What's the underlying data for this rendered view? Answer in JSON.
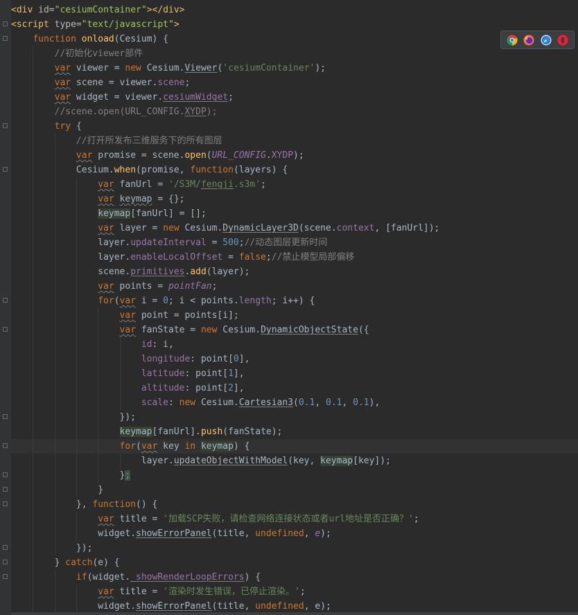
{
  "editor": {
    "lines": [
      {
        "indent": 0,
        "fold": false,
        "tokens": [
          [
            "tag",
            "<div "
          ],
          [
            "attr",
            "id="
          ],
          [
            "val",
            "\"cesiumContainer\""
          ],
          [
            "tag",
            "></div>"
          ]
        ]
      },
      {
        "indent": 0,
        "fold": true,
        "tokens": [
          [
            "tag",
            "<script "
          ],
          [
            "attr",
            "type="
          ],
          [
            "val",
            "\"text/javascript\""
          ],
          [
            "tag",
            ">"
          ]
        ]
      },
      {
        "indent": 1,
        "fold": true,
        "tokens": [
          [
            "kw",
            "function "
          ],
          [
            "fn",
            "onload"
          ],
          [
            "p",
            "(Cesium) {"
          ]
        ]
      },
      {
        "indent": 2,
        "fold": false,
        "tokens": [
          [
            "cmt",
            "//初始化viewer部件"
          ]
        ]
      },
      {
        "indent": 2,
        "fold": false,
        "tokens": [
          [
            "kw w",
            "var"
          ],
          [
            "p",
            " viewer = "
          ],
          [
            "kw",
            "new "
          ],
          [
            "p",
            "Cesium."
          ],
          [
            "p u",
            "Viewer"
          ],
          [
            "p",
            "("
          ],
          [
            "str",
            "'cesiumContainer'"
          ],
          [
            "p",
            ");"
          ]
        ]
      },
      {
        "indent": 2,
        "fold": false,
        "tokens": [
          [
            "kw w",
            "var"
          ],
          [
            "p",
            " scene = viewer."
          ],
          [
            "prop",
            "scene"
          ],
          [
            "p",
            ";"
          ]
        ]
      },
      {
        "indent": 2,
        "fold": false,
        "tokens": [
          [
            "kw w",
            "var"
          ],
          [
            "p",
            " widget = viewer."
          ],
          [
            "prop u",
            "cesiumWidget"
          ],
          [
            "p",
            ";"
          ]
        ]
      },
      {
        "indent": 2,
        "fold": false,
        "tokens": [
          [
            "cmt",
            "//scene.open(URL_CONFIG."
          ],
          [
            "cmt u",
            "XYDP"
          ],
          [
            "cmt",
            ");"
          ]
        ]
      },
      {
        "indent": 2,
        "fold": true,
        "tokens": [
          [
            "kw",
            "try "
          ],
          [
            "p",
            "{"
          ]
        ]
      },
      {
        "indent": 3,
        "fold": false,
        "tokens": [
          [
            "cmt",
            "//打开所发布三维服务下的所有图层"
          ]
        ]
      },
      {
        "indent": 3,
        "fold": false,
        "tokens": [
          [
            "kw w",
            "var"
          ],
          [
            "p",
            " promise = scene."
          ],
          [
            "fn",
            "open"
          ],
          [
            "p",
            "("
          ],
          [
            "glob",
            "URL_CONFIG"
          ],
          [
            "p",
            "."
          ],
          [
            "prop",
            "XYDP"
          ],
          [
            "p",
            ");"
          ]
        ]
      },
      {
        "indent": 3,
        "fold": true,
        "tokens": [
          [
            "p",
            "Cesium."
          ],
          [
            "fn",
            "when"
          ],
          [
            "p",
            "(promise, "
          ],
          [
            "kw",
            "function"
          ],
          [
            "p",
            "(layers) {"
          ]
        ]
      },
      {
        "indent": 4,
        "fold": false,
        "tokens": [
          [
            "kw w",
            "var"
          ],
          [
            "p",
            " fanUrl = "
          ],
          [
            "str",
            "'/S3M/"
          ],
          [
            "str u",
            "fengji"
          ],
          [
            "str",
            ".s3m'"
          ],
          [
            "p",
            ";"
          ]
        ]
      },
      {
        "indent": 4,
        "fold": false,
        "tokens": [
          [
            "kw w",
            "var"
          ],
          [
            "p",
            " "
          ],
          [
            "p w",
            "keymap"
          ],
          [
            "p",
            " = {};"
          ]
        ]
      },
      {
        "indent": 4,
        "fold": false,
        "tokens": [
          [
            "p hl",
            "keymap"
          ],
          [
            "p",
            "[fanUrl] = [];"
          ]
        ]
      },
      {
        "indent": 4,
        "fold": false,
        "tokens": [
          [
            "kw w",
            "var"
          ],
          [
            "p",
            " layer = "
          ],
          [
            "kw",
            "new "
          ],
          [
            "p",
            "Cesium."
          ],
          [
            "p u",
            "DynamicLayer3D"
          ],
          [
            "p",
            "(scene."
          ],
          [
            "prop",
            "context"
          ],
          [
            "p",
            ", [fanUrl]);"
          ]
        ]
      },
      {
        "indent": 4,
        "fold": false,
        "tokens": [
          [
            "p",
            "layer."
          ],
          [
            "prop",
            "updateInterval"
          ],
          [
            "p",
            " = "
          ],
          [
            "num",
            "500"
          ],
          [
            "p",
            ";"
          ],
          [
            "cmt",
            "//动态图层更新时间"
          ]
        ]
      },
      {
        "indent": 4,
        "fold": false,
        "tokens": [
          [
            "p",
            "layer."
          ],
          [
            "prop",
            "enableLocalOffset"
          ],
          [
            "p",
            " = "
          ],
          [
            "kw",
            "false"
          ],
          [
            "p",
            ";"
          ],
          [
            "cmt",
            "//禁止模型局部偏移"
          ]
        ]
      },
      {
        "indent": 4,
        "fold": false,
        "tokens": [
          [
            "p",
            "scene."
          ],
          [
            "prop u",
            "primitives"
          ],
          [
            "p",
            "."
          ],
          [
            "fn",
            "add"
          ],
          [
            "p",
            "(layer);"
          ]
        ]
      },
      {
        "indent": 4,
        "fold": false,
        "tokens": [
          [
            "kw w",
            "var"
          ],
          [
            "p",
            " points = "
          ],
          [
            "glob",
            "pointFan"
          ],
          [
            "p",
            ";"
          ]
        ]
      },
      {
        "indent": 4,
        "fold": true,
        "tokens": [
          [
            "kw",
            "for"
          ],
          [
            "p",
            "("
          ],
          [
            "kw w",
            "var"
          ],
          [
            "p",
            " i = "
          ],
          [
            "num",
            "0"
          ],
          [
            "p",
            "; i < points."
          ],
          [
            "prop",
            "length"
          ],
          [
            "p",
            "; i++) {"
          ]
        ]
      },
      {
        "indent": 5,
        "fold": false,
        "tokens": [
          [
            "kw w",
            "var"
          ],
          [
            "p",
            " point = points[i];"
          ]
        ]
      },
      {
        "indent": 5,
        "fold": true,
        "tokens": [
          [
            "kw w",
            "var"
          ],
          [
            "p",
            " fanState = "
          ],
          [
            "kw",
            "new "
          ],
          [
            "p",
            "Cesium."
          ],
          [
            "p u",
            "DynamicObjectState"
          ],
          [
            "p",
            "({"
          ]
        ]
      },
      {
        "indent": 6,
        "fold": false,
        "tokens": [
          [
            "prop",
            "id"
          ],
          [
            "p",
            ": i,"
          ]
        ]
      },
      {
        "indent": 6,
        "fold": false,
        "tokens": [
          [
            "prop",
            "longitude"
          ],
          [
            "p",
            ": point["
          ],
          [
            "num",
            "0"
          ],
          [
            "p",
            "],"
          ]
        ]
      },
      {
        "indent": 6,
        "fold": false,
        "tokens": [
          [
            "prop",
            "latitude"
          ],
          [
            "p",
            ": point["
          ],
          [
            "num",
            "1"
          ],
          [
            "p",
            "],"
          ]
        ]
      },
      {
        "indent": 6,
        "fold": false,
        "tokens": [
          [
            "prop",
            "altitude"
          ],
          [
            "p",
            ": point["
          ],
          [
            "num",
            "2"
          ],
          [
            "p",
            "],"
          ]
        ]
      },
      {
        "indent": 6,
        "fold": false,
        "tokens": [
          [
            "prop",
            "scale"
          ],
          [
            "p",
            ": "
          ],
          [
            "kw",
            "new "
          ],
          [
            "p",
            "Cesium."
          ],
          [
            "p u",
            "Cartesian3"
          ],
          [
            "p",
            "("
          ],
          [
            "num",
            "0.1"
          ],
          [
            "p",
            ", "
          ],
          [
            "num",
            "0.1"
          ],
          [
            "p",
            ", "
          ],
          [
            "num",
            "0.1"
          ],
          [
            "p",
            "),"
          ]
        ]
      },
      {
        "indent": 5,
        "fold": true,
        "tokens": [
          [
            "p",
            "});"
          ]
        ]
      },
      {
        "indent": 5,
        "fold": false,
        "tokens": [
          [
            "p hl",
            "keymap"
          ],
          [
            "p",
            "[fanUrl]."
          ],
          [
            "fn",
            "push"
          ],
          [
            "p",
            "(fanState);"
          ]
        ]
      },
      {
        "indent": 5,
        "fold": true,
        "cur": true,
        "tokens": [
          [
            "kw",
            "for"
          ],
          [
            "p",
            "("
          ],
          [
            "kw w",
            "var"
          ],
          [
            "p",
            " key "
          ],
          [
            "kw",
            "in "
          ],
          [
            "p hl",
            "ke"
          ],
          [
            "caret",
            ""
          ],
          [
            "p hl",
            "ymap"
          ],
          [
            "p",
            ") {"
          ]
        ]
      },
      {
        "indent": 6,
        "fold": false,
        "tokens": [
          [
            "p",
            "layer."
          ],
          [
            "p u",
            "updateObjectWithModel"
          ],
          [
            "p",
            "(key, "
          ],
          [
            "p hl",
            "keymap"
          ],
          [
            "p",
            "[key]);"
          ]
        ]
      },
      {
        "indent": 5,
        "fold": true,
        "tokens": [
          [
            "p",
            "}"
          ],
          [
            "kw semi-hl",
            ";"
          ]
        ]
      },
      {
        "indent": 4,
        "fold": true,
        "tokens": [
          [
            "p",
            "}"
          ]
        ]
      },
      {
        "indent": 3,
        "fold": true,
        "tokens": [
          [
            "p",
            "}, "
          ],
          [
            "kw",
            "function"
          ],
          [
            "p",
            "() {"
          ]
        ]
      },
      {
        "indent": 4,
        "fold": false,
        "tokens": [
          [
            "kw w",
            "var"
          ],
          [
            "p",
            " title = "
          ],
          [
            "str",
            "'加载SCP失败，请检查网络连接状态或者url地址是否正确？'"
          ],
          [
            "p",
            ";"
          ]
        ]
      },
      {
        "indent": 4,
        "fold": false,
        "tokens": [
          [
            "p",
            "widget."
          ],
          [
            "p u",
            "showErrorPanel"
          ],
          [
            "p",
            "(title, "
          ],
          [
            "kw",
            "undefined"
          ],
          [
            "p",
            ", "
          ],
          [
            "glob",
            "e"
          ],
          [
            "p",
            ");"
          ]
        ]
      },
      {
        "indent": 3,
        "fold": true,
        "tokens": [
          [
            "p",
            "});"
          ]
        ]
      },
      {
        "indent": 2,
        "fold": true,
        "tokens": [
          [
            "p",
            "} "
          ],
          [
            "kw",
            "catch"
          ],
          [
            "p",
            "(e) {"
          ]
        ]
      },
      {
        "indent": 3,
        "fold": true,
        "tokens": [
          [
            "kw",
            "if"
          ],
          [
            "p",
            "(widget."
          ],
          [
            "prop u",
            "_showRenderLoopErrors"
          ],
          [
            "p",
            ") {"
          ]
        ]
      },
      {
        "indent": 4,
        "fold": false,
        "tokens": [
          [
            "kw w",
            "var"
          ],
          [
            "p",
            " title = "
          ],
          [
            "str",
            "'渲染时发生错误，已停止渲染。'"
          ],
          [
            "p",
            ";"
          ]
        ]
      },
      {
        "indent": 4,
        "fold": false,
        "tokens": [
          [
            "p",
            "widget."
          ],
          [
            "p u",
            "showErrorPanel"
          ],
          [
            "p",
            "(title, "
          ],
          [
            "kw",
            "undefined"
          ],
          [
            "p",
            ", e);"
          ]
        ]
      }
    ]
  },
  "browser_toolbar": {
    "icons": [
      "chrome-icon",
      "firefox-icon",
      "safari-icon",
      "opera-icon"
    ]
  },
  "colors": {
    "background": "#2b2b2b",
    "keyword": "#cc7832",
    "string": "#6a8759",
    "number": "#6897bb",
    "property": "#9876aa",
    "function": "#ffc66d",
    "comment": "#808080"
  }
}
